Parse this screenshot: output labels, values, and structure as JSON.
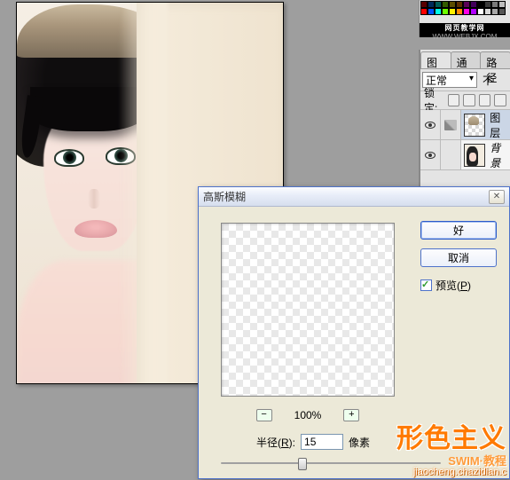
{
  "swatch_strip": {
    "brand_title": "网页教学网",
    "brand_url": "WWW.WEBJX.COM",
    "swatches": [
      "#5a0000",
      "#002b5a",
      "#005a55",
      "#325a00",
      "#5a4c00",
      "#5a2e00",
      "#5a0057",
      "#41005a",
      "#000000",
      "#3a3a3a",
      "#7a7a7a",
      "#bdbdbd",
      "#ff0000",
      "#0054ff",
      "#00ffe7",
      "#6dff00",
      "#fff000",
      "#ff8a00",
      "#ff00e6",
      "#b000ff",
      "#ffffff",
      "#d9d9d9",
      "#a6a6a6",
      "#555555"
    ]
  },
  "layers_panel": {
    "tabs": {
      "layers": "图层",
      "channels": "通道",
      "paths": "路径"
    },
    "blend_select": "正常",
    "opacity_label_suffix": "不",
    "lock_label": "锁定:",
    "layers": [
      {
        "name": "图层",
        "selected": true,
        "visible": true,
        "thumb": "checker"
      },
      {
        "name": "背景",
        "selected": false,
        "visible": true,
        "thumb": "portrait"
      }
    ]
  },
  "dialog": {
    "title": "高斯模糊",
    "ok": "好",
    "cancel": "取消",
    "preview_label": "预览(",
    "preview_key": "P",
    "preview_suffix": ")",
    "zoom_minus": "−",
    "zoom_plus": "+",
    "zoom_value": "100%",
    "radius_label_prefix": "半径(",
    "radius_key": "R",
    "radius_label_suffix": "):",
    "radius_value": "15",
    "radius_unit": "像素"
  },
  "watermark": {
    "main": "形色主义",
    "sub1": "SWIM·教程",
    "sub2": "jiaocheng.chazidian.c"
  }
}
